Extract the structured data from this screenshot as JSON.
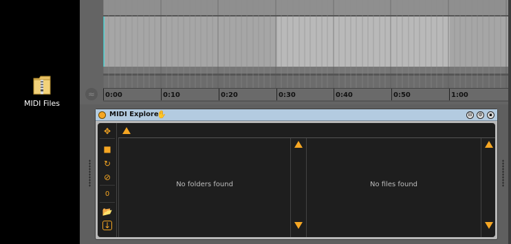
{
  "desktop": {
    "icon_label": "MIDI Files"
  },
  "arrangement": {
    "ruler_ticks": [
      "0:00",
      "0:10",
      "0:20",
      "0:30",
      "0:40",
      "0:50",
      "1:00"
    ]
  },
  "device": {
    "title": "MIDI Explorer",
    "folders_empty": "No folders found",
    "files_empty": "No files found",
    "counter": "0"
  },
  "colors": {
    "accent": "#f5a623",
    "title_bar": "#b3cbe0"
  }
}
